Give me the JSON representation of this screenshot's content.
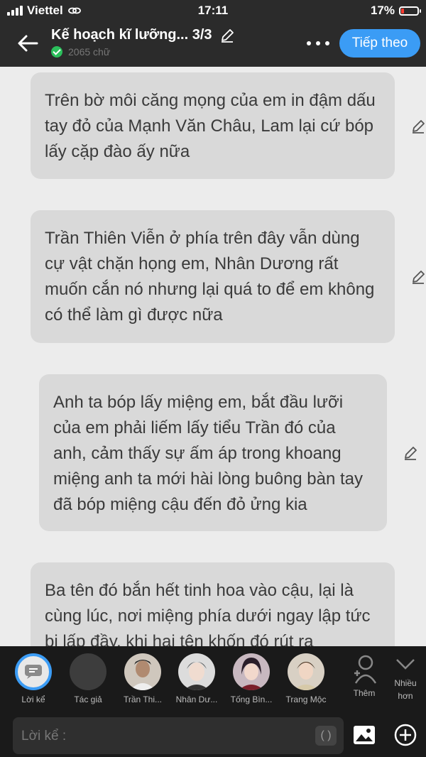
{
  "status": {
    "carrier": "Viettel",
    "time": "17:11",
    "battery": "17%"
  },
  "header": {
    "title": "Kế hoạch kĩ lưỡng... 3/3",
    "word_count": "2065 chữ",
    "next_label": "Tiếp theo"
  },
  "messages": [
    {
      "text": "Trên bờ môi căng mọng của em in đậm dấu tay đỏ của Mạnh Văn Châu, Lam lại cứ bóp lấy cặp đào ấy nữa"
    },
    {
      "text": "Trần Thiên Viễn ở phía trên đây vẫn dùng cự vật chặn họng em, Nhân Dương rất muốn cắn nó nhưng lại quá to để em không có thể làm gì được nữa"
    },
    {
      "text": "Anh ta bóp lấy miệng em, bắt đầu lưỡi của em phải liếm lấy tiểu Trần đó của anh, cảm thấy sự ấm áp trong khoang miệng anh ta mới hài lòng buông bàn tay đã bóp miệng cậu đến đỏ ửng kia"
    },
    {
      "text": "Ba tên đó bắn hết tinh hoa vào cậu, lại là cùng lúc, nơi miệng phía dưới ngay lập tức bị lấp đầy, khi hai tên khốn đó rút ra"
    }
  ],
  "characters": [
    {
      "name": "Lời kể"
    },
    {
      "name": "Tác giả"
    },
    {
      "name": "Trần Thi..."
    },
    {
      "name": "Nhân Dư..."
    },
    {
      "name": "Tống Bìn..."
    },
    {
      "name": "Trang Mộc"
    }
  ],
  "actions": {
    "add_label": "Thêm",
    "more_label_1": "Nhiều",
    "more_label_2": "hơn"
  },
  "composer": {
    "placeholder": "Lời kể :",
    "paren": "( )"
  },
  "colors": {
    "accent": "#3b9cf5",
    "bubble": "#d9d9d9",
    "header": "#2b2b2b"
  }
}
